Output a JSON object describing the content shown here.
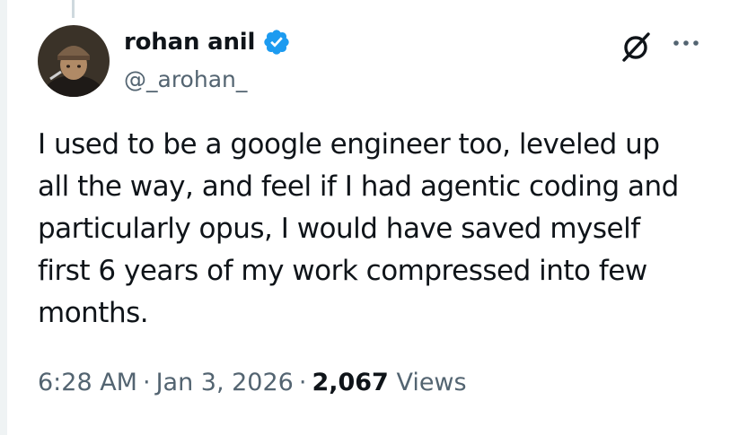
{
  "author": {
    "name": "rohan anil",
    "handle": "@_arohan_",
    "verified": true
  },
  "tweet": {
    "lines": [
      "I used to be a google engineer too, leveled up",
      "all the way, and feel if I had agentic coding and",
      "particularly opus, I would have saved myself",
      "first 6 years of my work compressed into few",
      "months."
    ]
  },
  "meta": {
    "time": "6:28 AM",
    "separator": "·",
    "date": "Jan 3, 2026",
    "views_count": "2,067",
    "views_label": "Views"
  },
  "icons": {
    "verified": "verified-badge-icon",
    "grok": "grok-icon",
    "more": "more-options-icon"
  },
  "colors": {
    "verified_blue": "#1d9bf0",
    "text_primary": "#0f1419",
    "text_secondary": "#536471"
  }
}
